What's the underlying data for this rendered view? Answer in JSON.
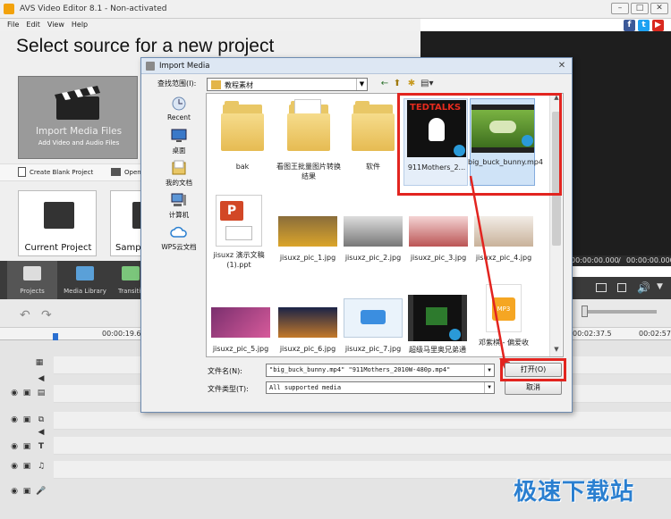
{
  "window": {
    "title": "AVS Video Editor 8.1 - Non-activated",
    "controls": {
      "minimize": "–",
      "maximize": "□",
      "close": "✕"
    }
  },
  "menu": [
    "File",
    "Edit",
    "View",
    "Help"
  ],
  "social": [
    {
      "name": "facebook",
      "glyph": "f",
      "color": "#3b5998"
    },
    {
      "name": "twitter",
      "glyph": "t",
      "color": "#1da1f2"
    },
    {
      "name": "youtube",
      "glyph": "▶",
      "color": "#d9281f"
    }
  ],
  "start": {
    "headline": "Select source for a new project",
    "import_title": "Import Media Files",
    "import_sub": "Add Video and Audio Files",
    "create_blank": "Create Blank Project",
    "open": "Open",
    "current_project": "Current Project",
    "sample": "Samp"
  },
  "tabs": [
    "Projects",
    "Media Library",
    "Transiti"
  ],
  "preview": {
    "time_left": "00:00:00.000",
    "time_sep": "/",
    "time_right": "00:00:00.000"
  },
  "timeline": {
    "ruler_marks": [
      "00:00:19.6",
      "00:02:37.5",
      "00:02:57"
    ]
  },
  "dialog": {
    "title": "Import Media",
    "lookin_label": "查找范围(I):",
    "lookin_value": "教程素材",
    "places": [
      "Recent",
      "桌面",
      "我的文档",
      "计算机",
      "WPS云文档"
    ],
    "files": [
      {
        "label": "bak",
        "kind": "folder"
      },
      {
        "label": "看图王批量图片转换结果",
        "kind": "folder"
      },
      {
        "label": "软件",
        "kind": "folder"
      },
      {
        "label": "911Mothers_2...",
        "kind": "video",
        "badge": "TEDTALKS"
      },
      {
        "label": "big_buck_bunny.mp4",
        "kind": "video"
      },
      {
        "label": "jisuxz 演示文稿(1).ppt",
        "kind": "ppt",
        "badge": "P"
      },
      {
        "label": "jisuxz_pic_1.jpg",
        "kind": "image"
      },
      {
        "label": "jisuxz_pic_2.jpg",
        "kind": "image"
      },
      {
        "label": "jisuxz_pic_3.jpg",
        "kind": "image"
      },
      {
        "label": "jisuxz_pic_4.jpg",
        "kind": "image"
      },
      {
        "label": "jisuxz_pic_5.jpg",
        "kind": "image"
      },
      {
        "label": "jisuxz_pic_6.jpg",
        "kind": "image"
      },
      {
        "label": "jisuxz_pic_7.jpg",
        "kind": "image"
      },
      {
        "label": "超级马里奥兄弟通",
        "kind": "video"
      },
      {
        "label": "邓紫棋 - 偏爱收",
        "kind": "mp3",
        "badge": "MP3"
      }
    ],
    "filename_label": "文件名(N):",
    "filename_value": "\"big_buck_bunny.mp4\" \"911Mothers_2010W-480p.mp4\"",
    "filetype_label": "文件类型(T):",
    "filetype_value": "All supported media",
    "open_button": "打开(O)",
    "cancel_button": "取消"
  },
  "watermark": "极速下载站",
  "colors": {
    "highlight": "#e2241f",
    "accent": "#2a7fd0"
  }
}
